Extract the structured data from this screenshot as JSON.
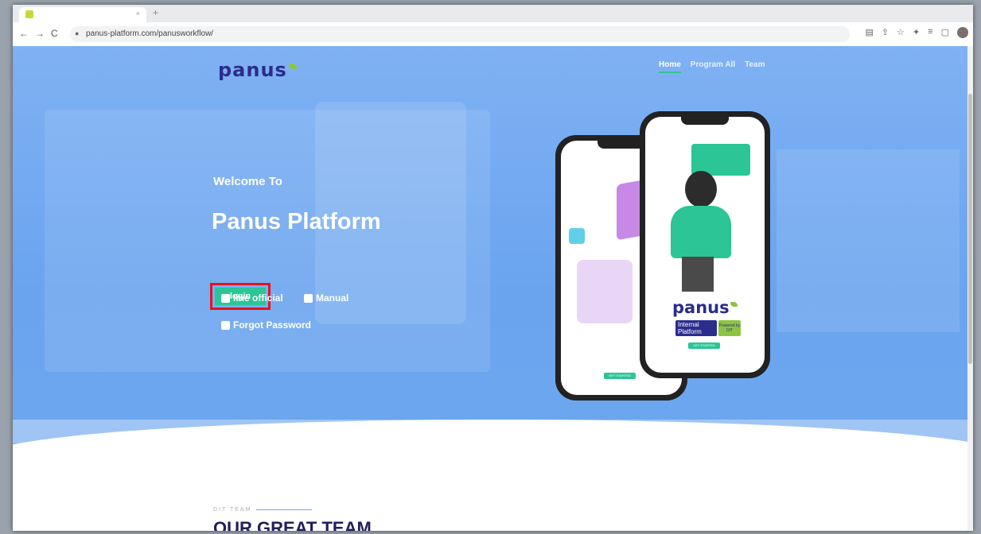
{
  "browser": {
    "tab_title": "",
    "tab_close": "×",
    "new_tab": "+",
    "back_icon": "←",
    "forward_icon": "→",
    "reload_icon": "C",
    "lock_icon": "🔒",
    "url": "panus-platform.com/panusworkflow/",
    "extension_icons": [
      "translate-icon",
      "share-icon",
      "star-icon",
      "extensions-icon",
      "reading-list-icon",
      "side-panel-icon",
      "profile-avatar"
    ],
    "ext_glyphs": [
      "▤",
      "⇪",
      "☆",
      "✦",
      "≡",
      "▢"
    ]
  },
  "site": {
    "logo": "panus",
    "nav": {
      "home": "Home",
      "program_all": "Program All",
      "team": "Team"
    }
  },
  "hero": {
    "welcome": "Welcome To",
    "title": "Panus Platform",
    "login_label": "login",
    "links": {
      "line_official": "line official",
      "manual": "Manual",
      "forgot_password": "Forgot Password"
    }
  },
  "phone_mockup": {
    "logo": "panus",
    "badge_internal": "Internal Platform",
    "badge_powered": "Powered by DIT",
    "get_started": "GET STARTED"
  },
  "team_section": {
    "eyebrow": "DIT TEAM",
    "heading": "OUR GREAT TEAM"
  },
  "colors": {
    "hero_blue": "#6aa4ef",
    "accent_green": "#2bc596",
    "brand_navy": "#2b2c8c",
    "highlight_red": "#e3141c"
  }
}
